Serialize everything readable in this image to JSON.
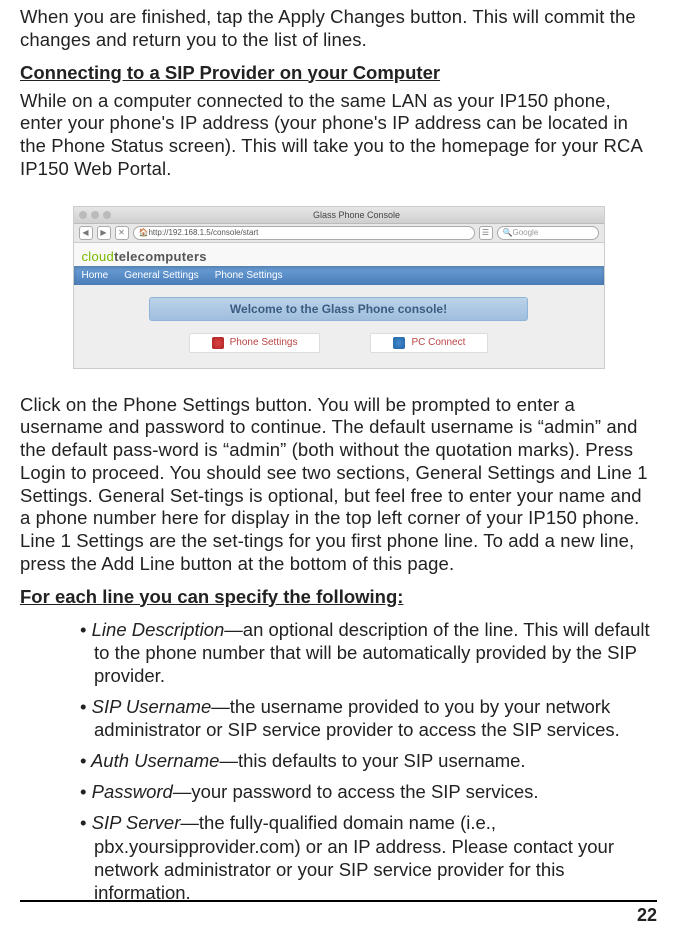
{
  "p1": "When you are finished, tap the Apply Changes button. This will commit the changes and return you to the list of lines.",
  "h1": "Connecting to a SIP Provider on your Computer",
  "p2": "While on a computer connected to the same LAN as your IP150 phone, enter your phone's IP address (your phone's IP address can be located in the Phone Status screen).  This will take you to the homepage for your RCA IP150 Web Portal.",
  "fig": {
    "title": "Glass Phone Console",
    "url": "http://192.168.1.5/console/start",
    "search_ph": "Google",
    "logo1": "cloud",
    "logo2": "telecomputers",
    "nav": [
      "Home",
      "General Settings",
      "Phone Settings"
    ],
    "welcome": "Welcome to the Glass Phone console!",
    "btn1": "Phone Settings",
    "btn2": "PC Connect"
  },
  "p3": "Click on the Phone Settings button.  You will be prompted to enter a username and password to continue.  The default username is “admin” and the default pass‐word is “admin” (both without the quotation marks).  Press Login to proceed.  You should see two sections, General Settings and Line 1 Settings.  General Set‐tings is optional, but feel free to enter your name and a phone number here for display in the top left corner of your IP150 phone.  Line 1 Settings are the set‐tings for you first phone line.  To add a new line, press the Add Line button at the bottom of this page.",
  "h2": "For each line you can specify the following:",
  "bullets": {
    "b1t": "Line Description",
    "b1r": "—an optional description of the line. This will default to the phone number that will be automatically provided by the SIP provider.",
    "b2t": " SIP Username",
    "b2r": "—the username provided to you by your network administrator or SIP service provider to access the SIP services.",
    "b3t": " Auth Username",
    "b3r": "—this defaults to your SIP username.",
    "b4t": " Password",
    "b4r": "—your password to access the SIP services.",
    "b5t": " SIP Server",
    "b5r": "—the fully-qualified domain name (i.e., pbx.yoursipprovider.com) or an IP address. Please contact your network administrator or your SIP service provider for this information."
  },
  "pagenum": "22"
}
